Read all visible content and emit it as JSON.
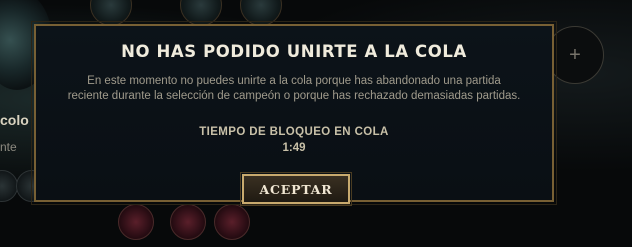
{
  "background": {
    "left_panel_title": "colo",
    "left_panel_subtitle": "nte",
    "plus_symbol": "+"
  },
  "modal": {
    "title": "NO HAS PODIDO UNIRTE A LA COLA",
    "message": "En este momento no puedes unirte a la cola porque has abandonado una partida reciente durante la selección de campeón o porque has rechazado demasiadas partidas.",
    "lockout_label": "TIEMPO DE BLOQUEO EN COLA",
    "lockout_time": "1:49",
    "accept_label": "ACEPTAR"
  },
  "colors": {
    "modal_border": "#786034",
    "button_border": "#c8aa6e",
    "title_text": "#f0ebdc"
  }
}
